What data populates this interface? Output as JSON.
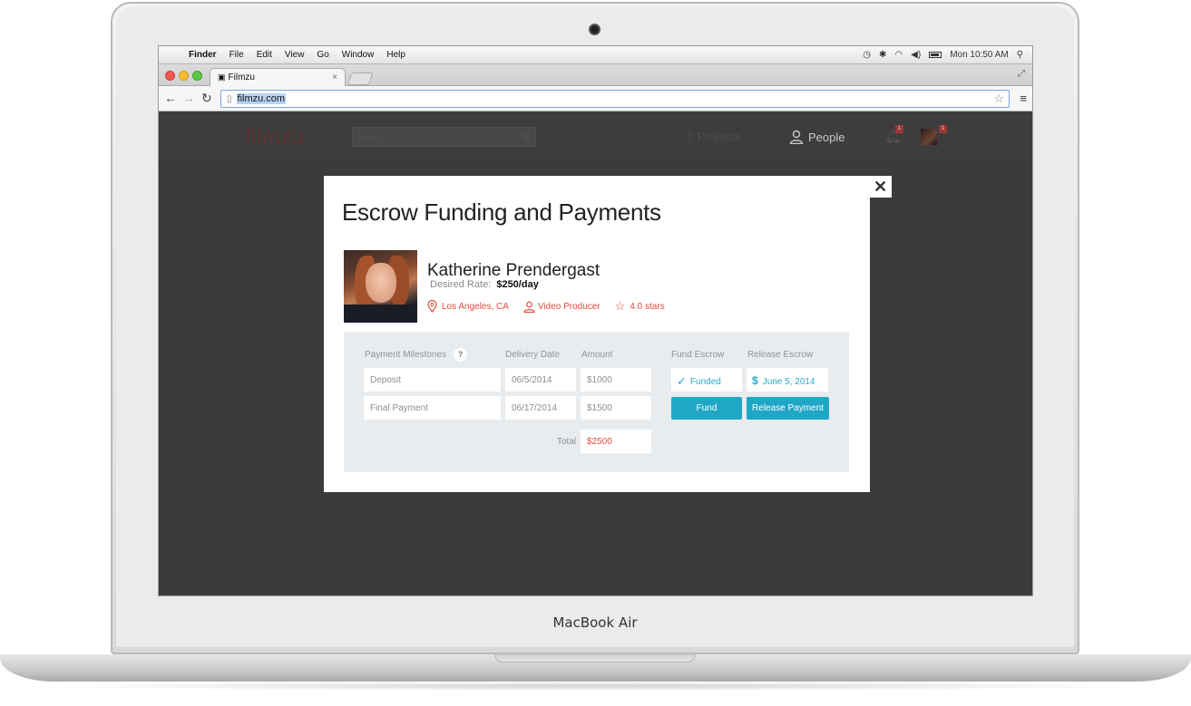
{
  "device": {
    "brand_label": "MacBook Air"
  },
  "mac_menubar": {
    "apple_glyph": "",
    "items": [
      "Finder",
      "File",
      "Edit",
      "View",
      "Go",
      "Window",
      "Help"
    ],
    "clock": "Mon 10:50 AM"
  },
  "browser": {
    "tab_title": "Filmzu",
    "tab_close": "×",
    "url": "filmzu.com"
  },
  "app_header": {
    "logo": "filmzu",
    "search_placeholder": "Search",
    "nav": {
      "projects": "Projects",
      "people": "People"
    },
    "notification_count": "1",
    "message_count": "1",
    "colors": {
      "logo": "#5a3433",
      "accent": "#e14a3b"
    }
  },
  "modal": {
    "title": "Escrow Funding and Payments",
    "close_glyph": "✕",
    "profile": {
      "name": "Katherine Prendergast",
      "rate_label": "Desired Rate:",
      "rate_value": "$250/day",
      "location": "Los Angeles, CA",
      "role": "Video Producer",
      "rating": "4.0 stars"
    },
    "table": {
      "headers": {
        "milestones": "Payment Milestones",
        "help": "?",
        "delivery_date": "Delivery Date",
        "amount": "Amount",
        "fund_escrow": "Fund Escrow",
        "release_escrow": "Release Escrow"
      },
      "rows": [
        {
          "milestone": "Deposit",
          "date": "06/5/2014",
          "amount": "$1000",
          "fund_status": "Funded",
          "release_status": "June 5, 2014"
        },
        {
          "milestone": "Final Payment",
          "date": "06/17/2014",
          "amount": "$1500",
          "fund_button": "Fund",
          "release_button": "Release Payment"
        }
      ],
      "total_label": "Total",
      "total_value": "$2500"
    },
    "colors": {
      "accent_red": "#e14a3b",
      "button_blue": "#20a7c6",
      "status_blue": "#25a9c8",
      "panel_bg": "#e8ecef"
    }
  }
}
